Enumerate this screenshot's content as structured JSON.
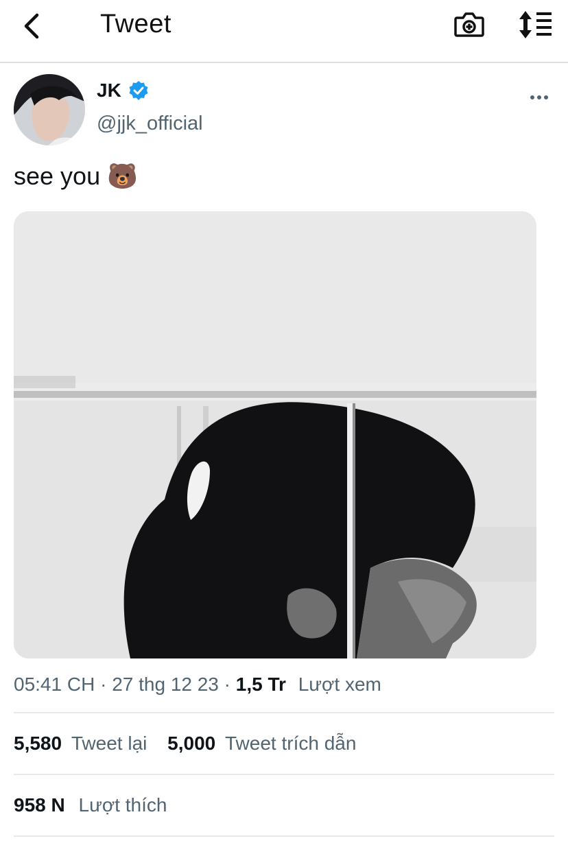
{
  "header": {
    "title": "Tweet",
    "icons": [
      "back-arrow-icon",
      "camera-plus-icon",
      "sort-lines-icon"
    ]
  },
  "tweet": {
    "display_name": "JK",
    "verified": true,
    "handle": "@jjk_official",
    "text": "see you 🐻",
    "time": "05:41 CH",
    "date": "27 thg 12 23",
    "views_count": "1,5 Tr",
    "views_label": "Lượt xem"
  },
  "stats": {
    "retweets_count": "5,580",
    "retweets_label": "Tweet lại",
    "quotes_count": "5,000",
    "quotes_label": "Tweet trích dẫn",
    "likes_count": "958 N",
    "likes_label": "Lượt thích"
  },
  "colors": {
    "verified": "#1d9bf0",
    "secondary_text": "#536471",
    "primary_text": "#0f1419"
  }
}
